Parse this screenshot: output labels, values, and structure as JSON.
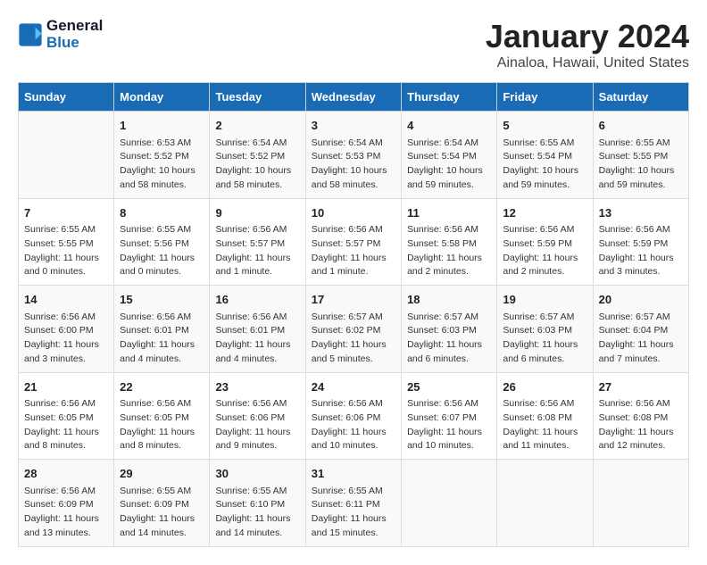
{
  "logo": {
    "text_general": "General",
    "text_blue": "Blue"
  },
  "title": "January 2024",
  "subtitle": "Ainaloa, Hawaii, United States",
  "headers": [
    "Sunday",
    "Monday",
    "Tuesday",
    "Wednesday",
    "Thursday",
    "Friday",
    "Saturday"
  ],
  "weeks": [
    [
      {
        "day": "",
        "sunrise": "",
        "sunset": "",
        "daylight": ""
      },
      {
        "day": "1",
        "sunrise": "Sunrise: 6:53 AM",
        "sunset": "Sunset: 5:52 PM",
        "daylight": "Daylight: 10 hours and 58 minutes."
      },
      {
        "day": "2",
        "sunrise": "Sunrise: 6:54 AM",
        "sunset": "Sunset: 5:52 PM",
        "daylight": "Daylight: 10 hours and 58 minutes."
      },
      {
        "day": "3",
        "sunrise": "Sunrise: 6:54 AM",
        "sunset": "Sunset: 5:53 PM",
        "daylight": "Daylight: 10 hours and 58 minutes."
      },
      {
        "day": "4",
        "sunrise": "Sunrise: 6:54 AM",
        "sunset": "Sunset: 5:54 PM",
        "daylight": "Daylight: 10 hours and 59 minutes."
      },
      {
        "day": "5",
        "sunrise": "Sunrise: 6:55 AM",
        "sunset": "Sunset: 5:54 PM",
        "daylight": "Daylight: 10 hours and 59 minutes."
      },
      {
        "day": "6",
        "sunrise": "Sunrise: 6:55 AM",
        "sunset": "Sunset: 5:55 PM",
        "daylight": "Daylight: 10 hours and 59 minutes."
      }
    ],
    [
      {
        "day": "7",
        "sunrise": "Sunrise: 6:55 AM",
        "sunset": "Sunset: 5:55 PM",
        "daylight": "Daylight: 11 hours and 0 minutes."
      },
      {
        "day": "8",
        "sunrise": "Sunrise: 6:55 AM",
        "sunset": "Sunset: 5:56 PM",
        "daylight": "Daylight: 11 hours and 0 minutes."
      },
      {
        "day": "9",
        "sunrise": "Sunrise: 6:56 AM",
        "sunset": "Sunset: 5:57 PM",
        "daylight": "Daylight: 11 hours and 1 minute."
      },
      {
        "day": "10",
        "sunrise": "Sunrise: 6:56 AM",
        "sunset": "Sunset: 5:57 PM",
        "daylight": "Daylight: 11 hours and 1 minute."
      },
      {
        "day": "11",
        "sunrise": "Sunrise: 6:56 AM",
        "sunset": "Sunset: 5:58 PM",
        "daylight": "Daylight: 11 hours and 2 minutes."
      },
      {
        "day": "12",
        "sunrise": "Sunrise: 6:56 AM",
        "sunset": "Sunset: 5:59 PM",
        "daylight": "Daylight: 11 hours and 2 minutes."
      },
      {
        "day": "13",
        "sunrise": "Sunrise: 6:56 AM",
        "sunset": "Sunset: 5:59 PM",
        "daylight": "Daylight: 11 hours and 3 minutes."
      }
    ],
    [
      {
        "day": "14",
        "sunrise": "Sunrise: 6:56 AM",
        "sunset": "Sunset: 6:00 PM",
        "daylight": "Daylight: 11 hours and 3 minutes."
      },
      {
        "day": "15",
        "sunrise": "Sunrise: 6:56 AM",
        "sunset": "Sunset: 6:01 PM",
        "daylight": "Daylight: 11 hours and 4 minutes."
      },
      {
        "day": "16",
        "sunrise": "Sunrise: 6:56 AM",
        "sunset": "Sunset: 6:01 PM",
        "daylight": "Daylight: 11 hours and 4 minutes."
      },
      {
        "day": "17",
        "sunrise": "Sunrise: 6:57 AM",
        "sunset": "Sunset: 6:02 PM",
        "daylight": "Daylight: 11 hours and 5 minutes."
      },
      {
        "day": "18",
        "sunrise": "Sunrise: 6:57 AM",
        "sunset": "Sunset: 6:03 PM",
        "daylight": "Daylight: 11 hours and 6 minutes."
      },
      {
        "day": "19",
        "sunrise": "Sunrise: 6:57 AM",
        "sunset": "Sunset: 6:03 PM",
        "daylight": "Daylight: 11 hours and 6 minutes."
      },
      {
        "day": "20",
        "sunrise": "Sunrise: 6:57 AM",
        "sunset": "Sunset: 6:04 PM",
        "daylight": "Daylight: 11 hours and 7 minutes."
      }
    ],
    [
      {
        "day": "21",
        "sunrise": "Sunrise: 6:56 AM",
        "sunset": "Sunset: 6:05 PM",
        "daylight": "Daylight: 11 hours and 8 minutes."
      },
      {
        "day": "22",
        "sunrise": "Sunrise: 6:56 AM",
        "sunset": "Sunset: 6:05 PM",
        "daylight": "Daylight: 11 hours and 8 minutes."
      },
      {
        "day": "23",
        "sunrise": "Sunrise: 6:56 AM",
        "sunset": "Sunset: 6:06 PM",
        "daylight": "Daylight: 11 hours and 9 minutes."
      },
      {
        "day": "24",
        "sunrise": "Sunrise: 6:56 AM",
        "sunset": "Sunset: 6:06 PM",
        "daylight": "Daylight: 11 hours and 10 minutes."
      },
      {
        "day": "25",
        "sunrise": "Sunrise: 6:56 AM",
        "sunset": "Sunset: 6:07 PM",
        "daylight": "Daylight: 11 hours and 10 minutes."
      },
      {
        "day": "26",
        "sunrise": "Sunrise: 6:56 AM",
        "sunset": "Sunset: 6:08 PM",
        "daylight": "Daylight: 11 hours and 11 minutes."
      },
      {
        "day": "27",
        "sunrise": "Sunrise: 6:56 AM",
        "sunset": "Sunset: 6:08 PM",
        "daylight": "Daylight: 11 hours and 12 minutes."
      }
    ],
    [
      {
        "day": "28",
        "sunrise": "Sunrise: 6:56 AM",
        "sunset": "Sunset: 6:09 PM",
        "daylight": "Daylight: 11 hours and 13 minutes."
      },
      {
        "day": "29",
        "sunrise": "Sunrise: 6:55 AM",
        "sunset": "Sunset: 6:09 PM",
        "daylight": "Daylight: 11 hours and 14 minutes."
      },
      {
        "day": "30",
        "sunrise": "Sunrise: 6:55 AM",
        "sunset": "Sunset: 6:10 PM",
        "daylight": "Daylight: 11 hours and 14 minutes."
      },
      {
        "day": "31",
        "sunrise": "Sunrise: 6:55 AM",
        "sunset": "Sunset: 6:11 PM",
        "daylight": "Daylight: 11 hours and 15 minutes."
      },
      {
        "day": "",
        "sunrise": "",
        "sunset": "",
        "daylight": ""
      },
      {
        "day": "",
        "sunrise": "",
        "sunset": "",
        "daylight": ""
      },
      {
        "day": "",
        "sunrise": "",
        "sunset": "",
        "daylight": ""
      }
    ]
  ]
}
